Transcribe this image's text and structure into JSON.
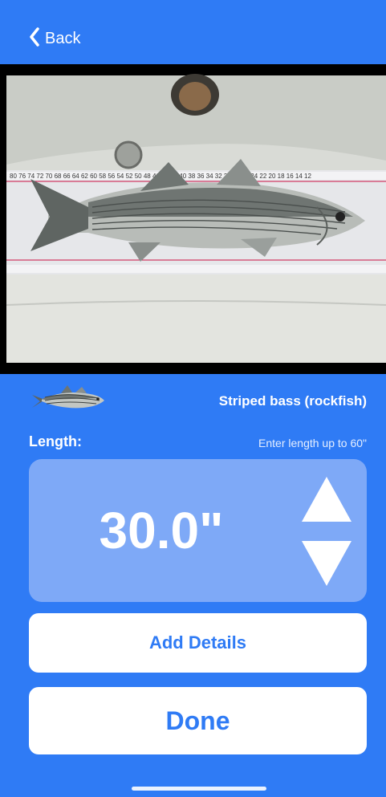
{
  "nav": {
    "back_label": "Back"
  },
  "photo": {
    "alt": "Striped bass on measuring board"
  },
  "species": {
    "name": "Striped bass (rockfish)"
  },
  "length": {
    "label": "Length:",
    "hint": "Enter length up to 60\"",
    "value": "30.0\""
  },
  "actions": {
    "add_details_label": "Add Details",
    "done_label": "Done"
  },
  "colors": {
    "background": "#2f7bf5",
    "panel": "#7ea9f7",
    "button_bg": "#ffffff",
    "button_text": "#2f7bf5"
  }
}
